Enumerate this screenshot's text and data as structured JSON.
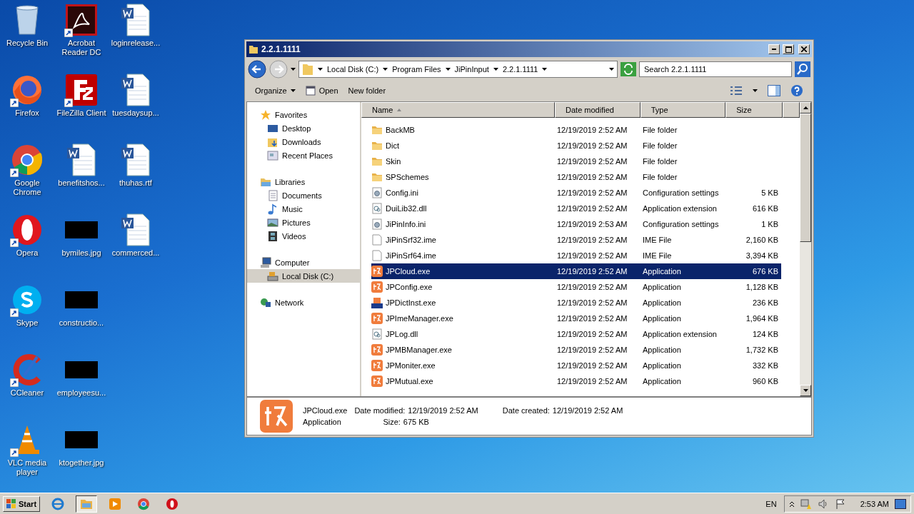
{
  "desktop_icons": [
    {
      "label": "Recycle Bin",
      "kind": "recycle",
      "shortcut": false
    },
    {
      "label": "Firefox",
      "kind": "firefox",
      "shortcut": true
    },
    {
      "label": "Google Chrome",
      "kind": "chrome",
      "shortcut": true
    },
    {
      "label": "Opera",
      "kind": "opera",
      "shortcut": true
    },
    {
      "label": "Skype",
      "kind": "skype",
      "shortcut": true
    },
    {
      "label": "CCleaner",
      "kind": "ccleaner",
      "shortcut": true
    },
    {
      "label": "VLC media player",
      "kind": "vlc",
      "shortcut": true
    },
    {
      "label": "Acrobat Reader DC",
      "kind": "acrobat",
      "shortcut": true
    },
    {
      "label": "FileZilla Client",
      "kind": "filezilla",
      "shortcut": true
    },
    {
      "label": "benefitshos...",
      "kind": "word",
      "shortcut": false
    },
    {
      "label": "bymiles.jpg",
      "kind": "image",
      "shortcut": false
    },
    {
      "label": "constructio...",
      "kind": "image",
      "shortcut": false
    },
    {
      "label": "employeesu...",
      "kind": "image",
      "shortcut": false
    },
    {
      "label": "ktogether.jpg",
      "kind": "image",
      "shortcut": false
    },
    {
      "label": "loginrelease...",
      "kind": "word",
      "shortcut": false
    },
    {
      "label": "tuesdaysup...",
      "kind": "word",
      "shortcut": false
    },
    {
      "label": "thuhas.rtf",
      "kind": "word",
      "shortcut": false
    },
    {
      "label": "commerced...",
      "kind": "word",
      "shortcut": false
    }
  ],
  "window": {
    "title": "2.2.1.1111",
    "breadcrumb": [
      "Local Disk (C:)",
      "Program Files",
      "JiPinInput",
      "2.2.1.1111"
    ],
    "search": {
      "placeholder": "Search 2.2.1.1111"
    },
    "toolbar": [
      "Organize",
      "Open",
      "New folder"
    ],
    "nav": [
      {
        "label": "Favorites",
        "kind": "star",
        "selected": false,
        "children": [
          {
            "label": "Desktop",
            "kind": "desktop",
            "selected": false
          },
          {
            "label": "Downloads",
            "kind": "downloads",
            "selected": false
          },
          {
            "label": "Recent Places",
            "kind": "recent",
            "selected": false
          }
        ]
      },
      {
        "label": "Libraries",
        "kind": "libraries",
        "selected": false,
        "children": [
          {
            "label": "Documents",
            "kind": "documents",
            "selected": false
          },
          {
            "label": "Music",
            "kind": "music",
            "selected": false
          },
          {
            "label": "Pictures",
            "kind": "pictures",
            "selected": false
          },
          {
            "label": "Videos",
            "kind": "videos",
            "selected": false
          }
        ]
      },
      {
        "label": "Computer",
        "kind": "computer",
        "selected": false,
        "children": [
          {
            "label": "Local Disk (C:)",
            "kind": "disk",
            "selected": true
          }
        ]
      },
      {
        "label": "Network",
        "kind": "network",
        "selected": false
      }
    ],
    "columns": [
      "Name",
      "Date modified",
      "Type",
      "Size"
    ],
    "rows": [
      {
        "name": "BackMB",
        "date": "12/19/2019 2:52 AM",
        "type": "File folder",
        "kind": "folder",
        "selected": false
      },
      {
        "name": "Dict",
        "date": "12/19/2019 2:52 AM",
        "type": "File folder",
        "kind": "folder",
        "selected": false
      },
      {
        "name": "Skin",
        "date": "12/19/2019 2:52 AM",
        "type": "File folder",
        "kind": "folder",
        "selected": false
      },
      {
        "name": "SPSchemes",
        "date": "12/19/2019 2:52 AM",
        "type": "File folder",
        "kind": "folder",
        "selected": false
      },
      {
        "name": "Config.ini",
        "date": "12/19/2019 2:52 AM",
        "type": "Configuration settings",
        "size": "5 KB",
        "kind": "ini",
        "selected": false
      },
      {
        "name": "DuiLib32.dll",
        "date": "12/19/2019 2:52 AM",
        "type": "Application extension",
        "size": "616 KB",
        "kind": "dll",
        "selected": false
      },
      {
        "name": "JiPinInfo.ini",
        "date": "12/19/2019 2:53 AM",
        "type": "Configuration settings",
        "size": "1 KB",
        "kind": "ini",
        "selected": false
      },
      {
        "name": "JiPinSrf32.ime",
        "date": "12/19/2019 2:52 AM",
        "type": "IME File",
        "size": "2,160 KB",
        "kind": "file",
        "selected": false
      },
      {
        "name": "JiPinSrf64.ime",
        "date": "12/19/2019 2:52 AM",
        "type": "IME File",
        "size": "3,394 KB",
        "kind": "file",
        "selected": false
      },
      {
        "name": "JPCloud.exe",
        "date": "12/19/2019 2:52 AM",
        "type": "Application",
        "size": "676 KB",
        "kind": "app",
        "selected": true
      },
      {
        "name": "JPConfig.exe",
        "date": "12/19/2019 2:52 AM",
        "type": "Application",
        "size": "1,128 KB",
        "kind": "app",
        "selected": false
      },
      {
        "name": "JPDictInst.exe",
        "date": "12/19/2019 2:52 AM",
        "type": "Application",
        "size": "236 KB",
        "kind": "installer",
        "selected": false
      },
      {
        "name": "JPImeManager.exe",
        "date": "12/19/2019 2:52 AM",
        "type": "Application",
        "size": "1,964 KB",
        "kind": "app",
        "selected": false
      },
      {
        "name": "JPLog.dll",
        "date": "12/19/2019 2:52 AM",
        "type": "Application extension",
        "size": "124 KB",
        "kind": "dll",
        "selected": false
      },
      {
        "name": "JPMBManager.exe",
        "date": "12/19/2019 2:52 AM",
        "type": "Application",
        "size": "1,732 KB",
        "kind": "app",
        "selected": false
      },
      {
        "name": "JPMoniter.exe",
        "date": "12/19/2019 2:52 AM",
        "type": "Application",
        "size": "332 KB",
        "kind": "app",
        "selected": false
      },
      {
        "name": "JPMutual.exe",
        "date": "12/19/2019 2:52 AM",
        "type": "Application",
        "size": "960 KB",
        "kind": "app",
        "selected": false
      }
    ],
    "details": {
      "name": "JPCloud.exe",
      "type": "Application",
      "modified_label": "Date modified:",
      "modified": "12/19/2019 2:52 AM",
      "created_label": "Date created:",
      "created": "12/19/2019 2:52 AM",
      "size_label": "Size:",
      "size": "675 KB"
    }
  },
  "taskbar": {
    "start": "Start",
    "apps": [
      {
        "kind": "ie",
        "selected": false
      },
      {
        "kind": "explorer",
        "selected": true
      },
      {
        "kind": "media",
        "selected": false
      },
      {
        "kind": "chrome",
        "selected": false
      },
      {
        "kind": "opera",
        "selected": false
      }
    ],
    "language": "EN",
    "time": "2:53 AM"
  }
}
